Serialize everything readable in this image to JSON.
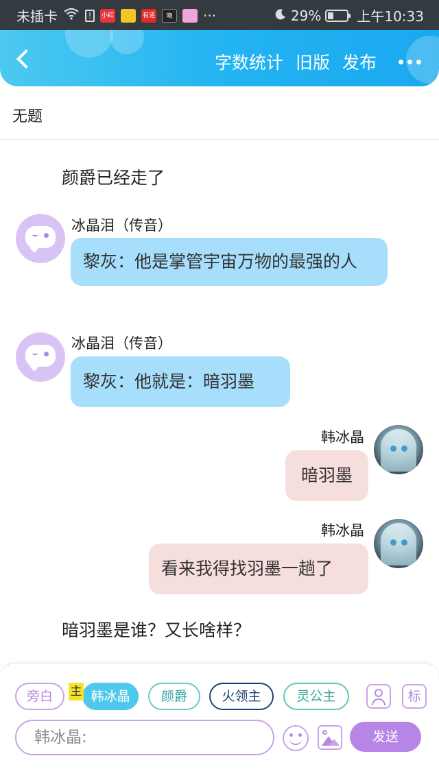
{
  "status_bar": {
    "carrier": "未插卡",
    "battery": "29%",
    "battery_level": 0.29,
    "time": "上午10:33",
    "more": "···",
    "apps": [
      {
        "icon": "xiaohongshu-app-icon",
        "label": "小红书",
        "color": "#e6353e"
      },
      {
        "icon": "emoji-app-icon",
        "label": "",
        "color": "#f3c623"
      },
      {
        "icon": "youdao-app-icon",
        "label": "有道",
        "color": "#e02b2b"
      },
      {
        "icon": "xiao-app-icon",
        "label": "晓",
        "color": "#222222"
      },
      {
        "icon": "camera-app-icon",
        "label": "",
        "color": "#f0a6d6"
      }
    ]
  },
  "header": {
    "word_count": "字数统计",
    "old_version": "旧版",
    "publish": "发布"
  },
  "title": "无题",
  "messages": {
    "narration_1": "颜爵已经走了",
    "msg1_name": "冰晶泪（传音）",
    "msg1_text": "黎灰：他是掌管宇宙万物的最强的人",
    "msg2_name": "冰晶泪（传音）",
    "msg2_text": "黎灰：他就是：暗羽墨",
    "msg3_name": "韩冰晶",
    "msg3_text": "暗羽墨",
    "msg4_name": "韩冰晶",
    "msg4_text": "看来我得找羽墨一趟了",
    "narration_2": "暗羽墨是谁？又长啥样？"
  },
  "input_panel": {
    "chips": {
      "narration": "旁白",
      "main_tag": "主",
      "active_role": "韩冰晶",
      "role_2": "颜爵",
      "role_3": "火领主",
      "role_4": "灵公主"
    },
    "tag_button": "标",
    "input_placeholder": "韩冰晶:",
    "send": "发送"
  },
  "colors": {
    "header_accent": "#23b4f2",
    "left_bubble": "#a6defb",
    "right_bubble": "#f6dedc",
    "send_button": "#b785e6"
  }
}
